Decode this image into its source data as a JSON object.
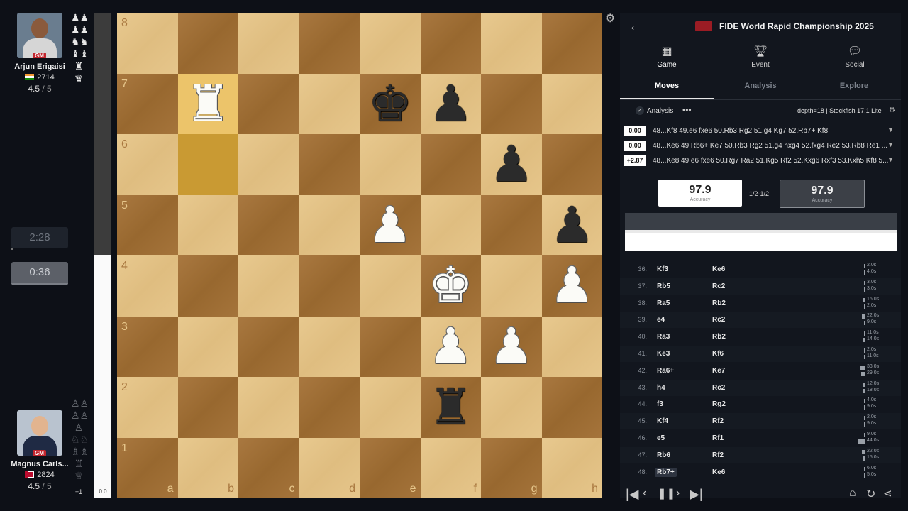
{
  "top_player": {
    "name": "Arjun Erigaisi",
    "title": "GM",
    "rating": "2714",
    "score": "4.5",
    "score_total": "/ 5",
    "captured": [
      "♟︎♟︎",
      "♟︎♟︎",
      "♞♞",
      "♝♝",
      "♜",
      "♛"
    ],
    "clock": "2:28"
  },
  "bottom_player": {
    "name": "Magnus Carls...",
    "title": "GM",
    "rating": "2824",
    "score": "4.5",
    "score_total": "/ 5",
    "captured": [
      "♙♙",
      "♙♙",
      "♙",
      "♘♘",
      "♗♗",
      "♖",
      "♕"
    ],
    "advantage": "+1",
    "clock": "0:36"
  },
  "eval_bar": {
    "label": "0.0",
    "white_fraction": 0.5
  },
  "board": {
    "ranks": [
      "8",
      "7",
      "6",
      "5",
      "4",
      "3",
      "2",
      "1"
    ],
    "files": [
      "a",
      "b",
      "c",
      "d",
      "e",
      "f",
      "g",
      "h"
    ],
    "pieces": [
      {
        "sq": "b7",
        "glyph": "♜",
        "color": "white",
        "name": "white-rook"
      },
      {
        "sq": "e7",
        "glyph": "♚",
        "color": "black",
        "name": "black-king"
      },
      {
        "sq": "f7",
        "glyph": "♟",
        "color": "black",
        "name": "black-pawn"
      },
      {
        "sq": "g6",
        "glyph": "♟",
        "color": "black",
        "name": "black-pawn"
      },
      {
        "sq": "e5",
        "glyph": "♟",
        "color": "white",
        "name": "white-pawn"
      },
      {
        "sq": "h5",
        "glyph": "♟",
        "color": "black",
        "name": "black-pawn"
      },
      {
        "sq": "f4",
        "glyph": "♚",
        "color": "white",
        "name": "white-king"
      },
      {
        "sq": "h4",
        "glyph": "♟",
        "color": "white",
        "name": "white-pawn"
      },
      {
        "sq": "f3",
        "glyph": "♟",
        "color": "white",
        "name": "white-pawn"
      },
      {
        "sq": "g3",
        "glyph": "♟",
        "color": "white",
        "name": "white-pawn"
      },
      {
        "sq": "f2",
        "glyph": "♜",
        "color": "black",
        "name": "black-rook"
      }
    ],
    "highlight": [
      "b7",
      "b6"
    ]
  },
  "header": {
    "title": "FIDE World Rapid Championship 2025"
  },
  "nav": [
    {
      "label": "Game",
      "icon": "board-icon"
    },
    {
      "label": "Event",
      "icon": "trophy-icon"
    },
    {
      "label": "Social",
      "icon": "chat-icon"
    }
  ],
  "tabs": [
    "Moves",
    "Analysis",
    "Explore"
  ],
  "analysis": {
    "label": "Analysis",
    "engine": "depth=18 | Stockfish 17.1 Lite"
  },
  "lines": [
    {
      "score": "0.00",
      "text": "48...Kf8 49.e6 fxe6 50.Rb3 Rg2 51.g4 Kg7 52.Rb7+ Kf8"
    },
    {
      "score": "0.00",
      "text": "48...Ke6 49.Rb6+ Ke7 50.Rb3 Rg2 51.g4 hxg4 52.fxg4 Re2 53.Rb8 Re1 ..."
    },
    {
      "score": "+2.87",
      "text": "48...Ke8 49.e6 fxe6 50.Rg7 Ra2 51.Kg5 Rf2 52.Kxg6 Rxf3 53.Kxh5 Kf8 5..."
    }
  ],
  "accuracy": {
    "white": "97.9",
    "black": "97.9",
    "label": "Accuracy",
    "result": "1/2-1/2"
  },
  "moves": [
    {
      "n": "36.",
      "w": "Kf3",
      "b": "Ke6",
      "tw": "2.0s",
      "tb": "4.0s",
      "fw": 0.06,
      "fb": 0.1
    },
    {
      "n": "37.",
      "w": "Rb5",
      "b": "Rc2",
      "tw": "3.0s",
      "tb": "3.0s",
      "fw": 0.08,
      "fb": 0.08
    },
    {
      "n": "38.",
      "w": "Ra5",
      "b": "Rb2",
      "tw": "16.0s",
      "tb": "2.0s",
      "fw": 0.35,
      "fb": 0.06
    },
    {
      "n": "39.",
      "w": "e4",
      "b": "Rc2",
      "tw": "22.0s",
      "tb": "9.0s",
      "fw": 0.5,
      "fb": 0.2
    },
    {
      "n": "40.",
      "w": "Ra3",
      "b": "Rb2",
      "tw": "11.0s",
      "tb": "14.0s",
      "fw": 0.25,
      "fb": 0.3
    },
    {
      "n": "41.",
      "w": "Ke3",
      "b": "Kf6",
      "tw": "2.0s",
      "tb": "11.0s",
      "fw": 0.06,
      "fb": 0.25
    },
    {
      "n": "42.",
      "w": "Ra6+",
      "b": "Ke7",
      "tw": "33.0s",
      "tb": "29.0s",
      "fw": 0.75,
      "fb": 0.65
    },
    {
      "n": "43.",
      "w": "h4",
      "b": "Rc2",
      "tw": "12.0s",
      "tb": "18.0s",
      "fw": 0.27,
      "fb": 0.4
    },
    {
      "n": "44.",
      "w": "f3",
      "b": "Rg2",
      "tw": "4.0s",
      "tb": "9.0s",
      "fw": 0.1,
      "fb": 0.2
    },
    {
      "n": "45.",
      "w": "Kf4",
      "b": "Rf2",
      "tw": "2.0s",
      "tb": "9.0s",
      "fw": 0.06,
      "fb": 0.2
    },
    {
      "n": "46.",
      "w": "e5",
      "b": "Rf1",
      "tw": "9.0s",
      "tb": "44.0s",
      "fw": 0.2,
      "fb": 1.0
    },
    {
      "n": "47.",
      "w": "Rb6",
      "b": "Rf2",
      "tw": "22.0s",
      "tb": "15.0s",
      "fw": 0.5,
      "fb": 0.34
    },
    {
      "n": "48.",
      "w": "Rb7+",
      "b": "Ke6",
      "tw": "6.0s",
      "tb": "5.0s",
      "fw": 0.14,
      "fb": 0.12
    }
  ]
}
